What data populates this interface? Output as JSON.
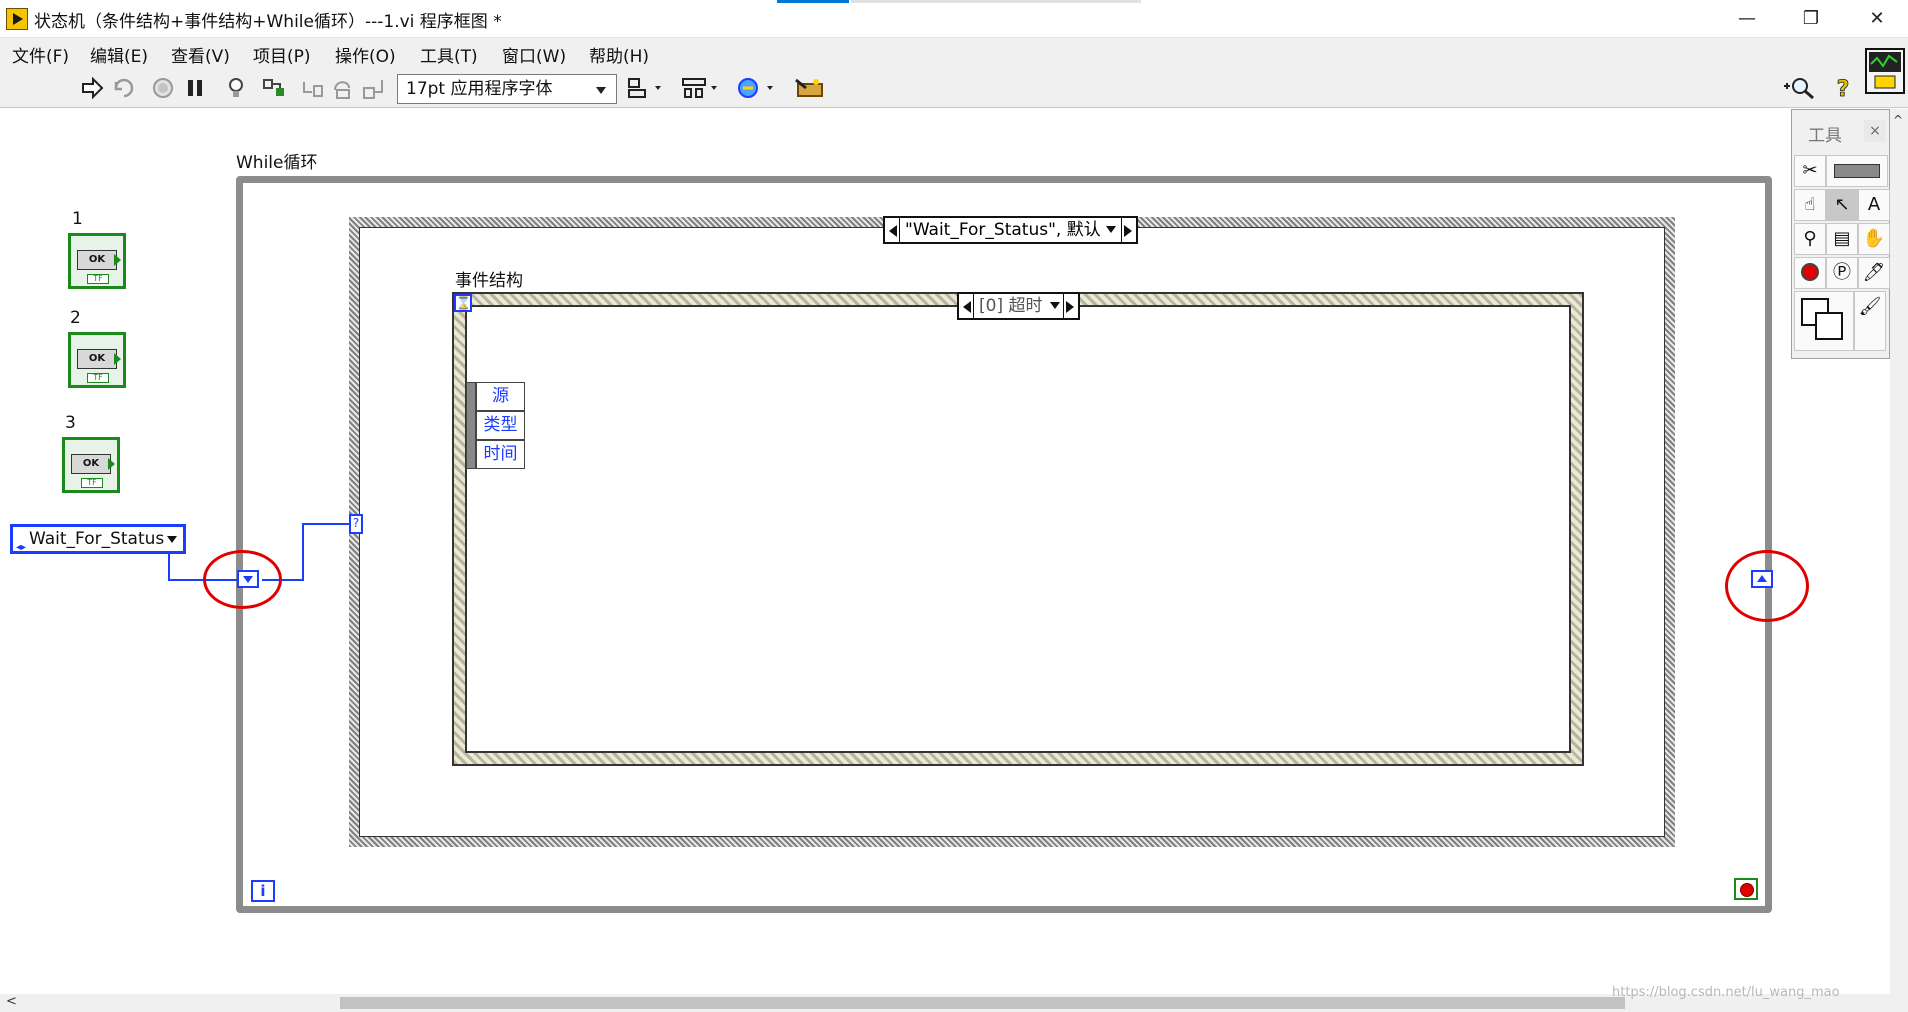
{
  "window": {
    "title": "状态机（条件结构+事件结构+While循环）---1.vi 程序框图 *",
    "minimize": "—",
    "maximize": "❐",
    "close": "✕"
  },
  "menu": [
    "文件(F)",
    "编辑(E)",
    "查看(V)",
    "项目(P)",
    "操作(O)",
    "工具(T)",
    "窗口(W)",
    "帮助(H)"
  ],
  "toolbar": {
    "font": "17pt 应用程序字体"
  },
  "diagram": {
    "while_label": "While循环",
    "event_label": "事件结构",
    "case_selector": "\"Wait_For_Status\", 默认",
    "event_selector": "[0] 超时",
    "event_data": [
      "源",
      "类型",
      "时间"
    ],
    "controls": [
      {
        "label": "1",
        "caption": "OK",
        "tf": "TF"
      },
      {
        "label": "2",
        "caption": "OK",
        "tf": "TF"
      },
      {
        "label": "3",
        "caption": "OK",
        "tf": "TF"
      }
    ],
    "enum_value": "Wait_For_Status",
    "case_terminal": "?",
    "iteration_terminal": "i",
    "timeout_terminal": "⌛"
  },
  "tools_palette": {
    "title": "工具",
    "close": "×"
  },
  "watermark": "https://blog.csdn.net/lu_wang_mao",
  "colors": {
    "wire": "#1a3dff",
    "boolean": "#1a8a1a",
    "highlight": "#e00000"
  }
}
